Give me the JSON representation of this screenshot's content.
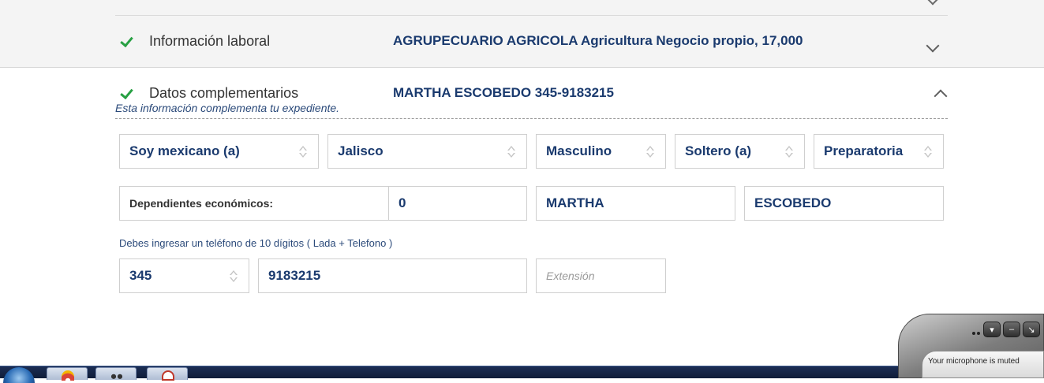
{
  "sections": {
    "laboral": {
      "label": "Información laboral",
      "value": "AGRUPECUARIO AGRICOLA Agricultura Negocio propio, 17,000"
    },
    "complementarios": {
      "label": "Datos complementarios",
      "value": "MARTHA ESCOBEDO 345-9183215",
      "note": "Esta información complementa tu expediente."
    }
  },
  "form": {
    "nationality": "Soy mexicano (a)",
    "state": "Jalisco",
    "gender": "Masculino",
    "marital_status": "Soltero (a)",
    "education": "Preparatoria",
    "dependents_label": "Dependientes económicos:",
    "dependents_value": "0",
    "first_name": "MARTHA",
    "last_name": "ESCOBEDO",
    "phone_note": "Debes ingresar un teléfono de 10 dígitos ( Lada + Telefono )",
    "lada": "345",
    "phone": "9183215",
    "extension_placeholder": "Extensión"
  },
  "mic_widget": {
    "status": "Your microphone is muted"
  },
  "colors": {
    "accent_navy": "#1a3a6e",
    "check_green": "#27a043"
  }
}
